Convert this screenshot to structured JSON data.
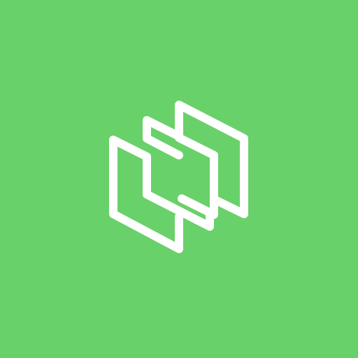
{
  "icon": {
    "name": "stacked-panels-logo-icon",
    "background_color": "#69D169",
    "foreground_color": "#FFFFFF"
  }
}
